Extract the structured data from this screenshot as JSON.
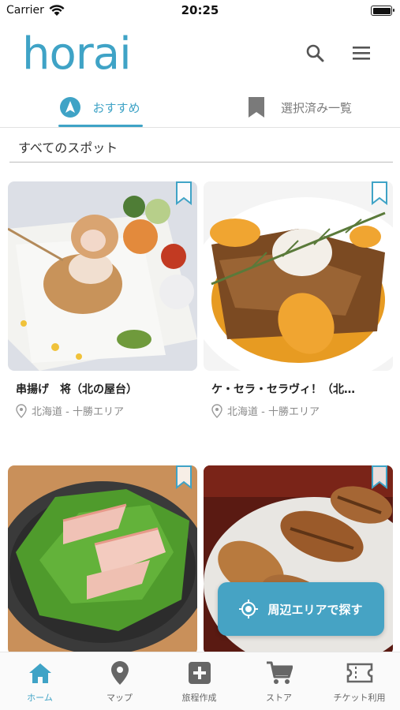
{
  "status_bar": {
    "carrier": "Carrier",
    "time": "20:25"
  },
  "header": {
    "logo": "horai",
    "icons": [
      "search-icon",
      "menu-icon"
    ]
  },
  "tabs": [
    {
      "label": "おすすめ",
      "icon": "compass-icon",
      "active": true
    },
    {
      "label": "選択済み一覧",
      "icon": "bookmark-icon",
      "active": false
    }
  ],
  "section": {
    "title": "すべてのスポット"
  },
  "spots": [
    {
      "name": "串揚げ　将（北の屋台）",
      "location": "北海道 - 十勝エリア"
    },
    {
      "name": "ケ・セラ・セラヴィ！（北…",
      "location": "北海道 - 十勝エリア"
    },
    {
      "name": "",
      "location": ""
    },
    {
      "name": "",
      "location": ""
    }
  ],
  "fab": {
    "label": "周辺エリアで探す",
    "icon": "locate-icon"
  },
  "bottom_nav": [
    {
      "label": "ホーム",
      "icon": "home-icon",
      "active": true
    },
    {
      "label": "マップ",
      "icon": "map-pin-icon",
      "active": false
    },
    {
      "label": "旅程作成",
      "icon": "plus-square-icon",
      "active": false
    },
    {
      "label": "ストア",
      "icon": "cart-icon",
      "active": false
    },
    {
      "label": "チケット利用",
      "icon": "ticket-icon",
      "active": false
    }
  ],
  "colors": {
    "accent": "#3fa3c6",
    "fab": "#46a3c4",
    "inactive": "#7a7a7a"
  }
}
